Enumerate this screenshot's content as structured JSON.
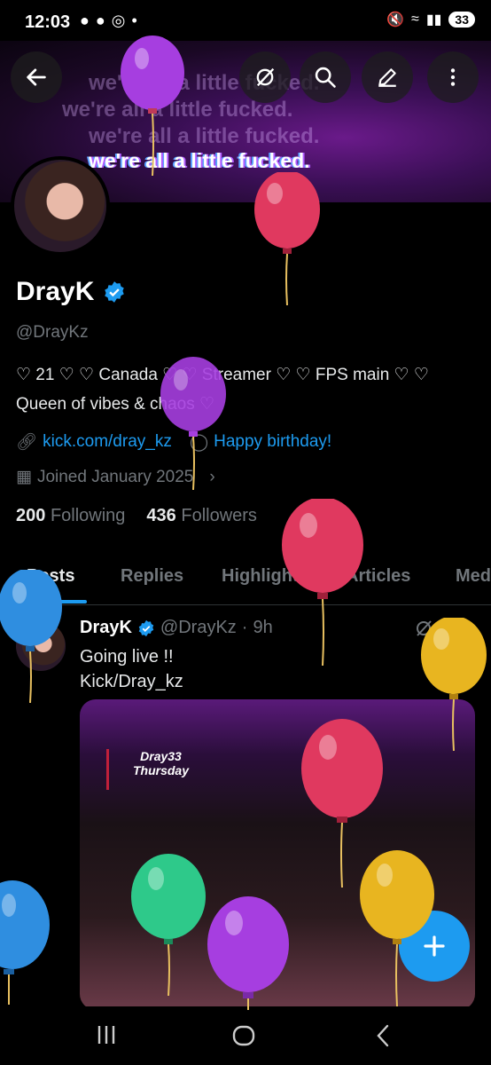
{
  "status_bar": {
    "time": "12:03",
    "battery": "33"
  },
  "banner": {
    "tagline": "we're all a little fucked."
  },
  "header_icons": [
    "back-arrow-icon",
    "grok-icon",
    "search-icon",
    "edit-icon",
    "more-icon"
  ],
  "profile": {
    "name": "DrayK",
    "handle": "@DrayKz",
    "bio_line1": "♡ 21 ♡ ♡ Canada ♡ ♡ Streamer ♡ ♡ FPS main ♡ ♡",
    "bio_line2": "Queen of vibes & chaos ♡",
    "link": "kick.com/dray_kz",
    "birthday": "Happy birthday!",
    "joined": "Joined January 2025",
    "following_count": "200",
    "following_label": "Following",
    "followers_count": "436",
    "followers_label": "Followers"
  },
  "tabs": [
    "Posts",
    "Replies",
    "Highlights",
    "Articles",
    "Media"
  ],
  "post": {
    "name": "DrayK",
    "handle": "@DrayKz",
    "time": "9h",
    "line1": "Going live !!",
    "line2": "Kick/Dray_kz",
    "media_note_line1": "Dray33",
    "media_note_line2": "Thursday"
  },
  "colors": {
    "accent": "#1d9bf0",
    "background": "#000000"
  }
}
